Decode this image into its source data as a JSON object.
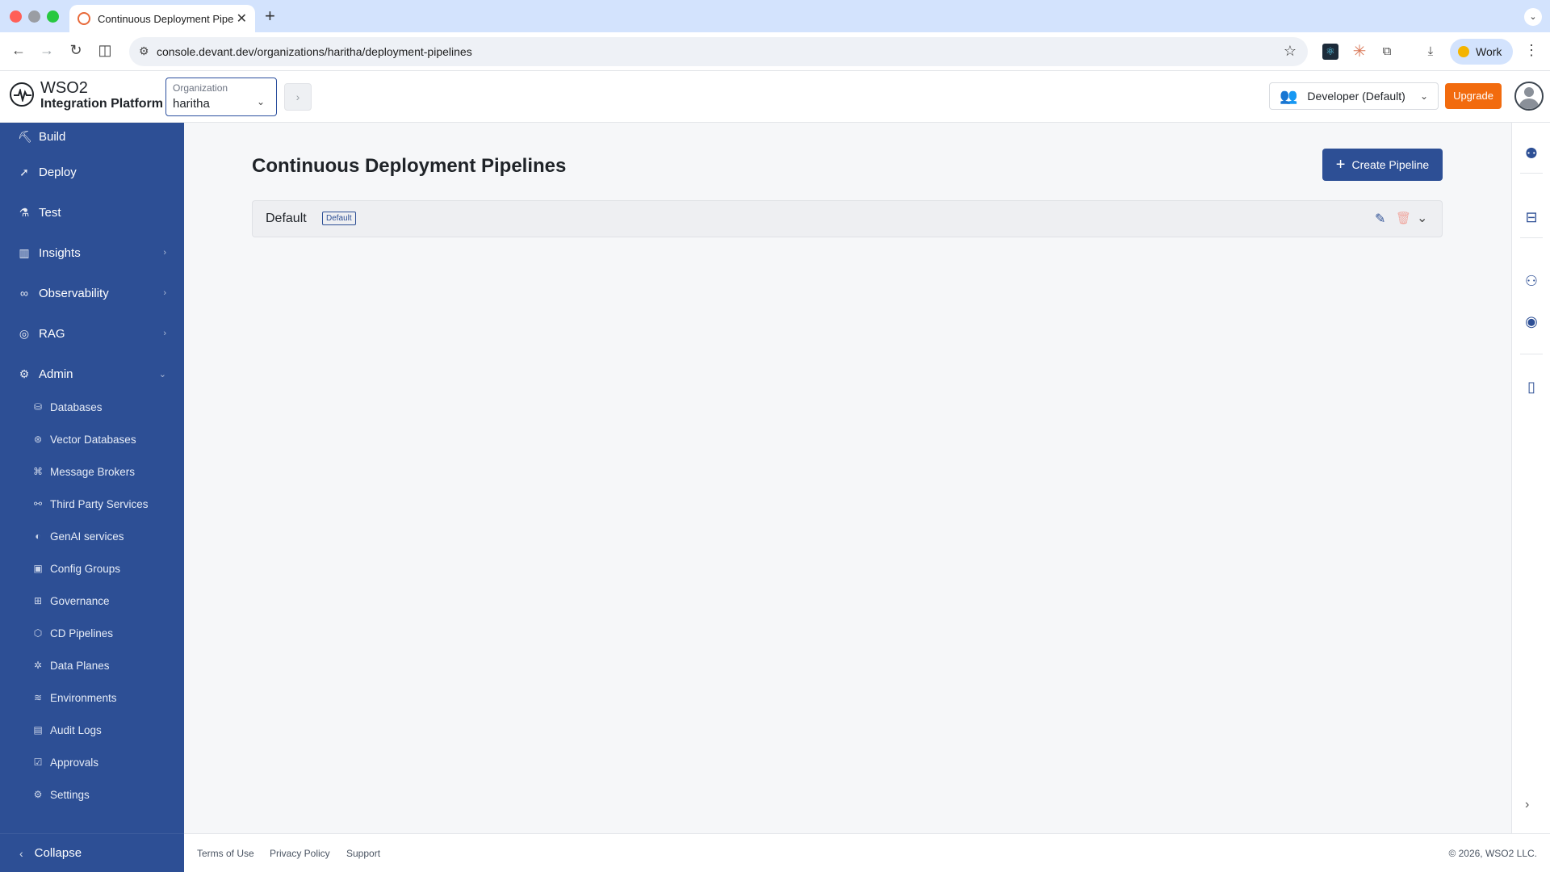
{
  "browser": {
    "tab_title": "Continuous Deployment Pipe",
    "url": "console.devant.dev/organizations/haritha/deployment-pipelines",
    "profile_label": "Work"
  },
  "header": {
    "logo_line1": "WSO2",
    "logo_line2": "Integration Platform",
    "org_label": "Organization",
    "org_value": "haritha",
    "role": "Developer (Default)",
    "upgrade_label": "Upgrade"
  },
  "sidebar": {
    "items": [
      {
        "label": "Build",
        "icon": "build-icon"
      },
      {
        "label": "Deploy",
        "icon": "rocket-icon"
      },
      {
        "label": "Test",
        "icon": "flask-icon"
      },
      {
        "label": "Insights",
        "icon": "chart-icon"
      },
      {
        "label": "Observability",
        "icon": "binoculars-icon"
      },
      {
        "label": "RAG",
        "icon": "brain-icon"
      },
      {
        "label": "Admin",
        "icon": "admin-icon"
      }
    ],
    "admin_items": [
      {
        "label": "Databases",
        "icon": "database-icon"
      },
      {
        "label": "Vector Databases",
        "icon": "vector-database-icon"
      },
      {
        "label": "Message Brokers",
        "icon": "broker-icon"
      },
      {
        "label": "Third Party Services",
        "icon": "services-icon"
      },
      {
        "label": "GenAI services",
        "icon": "genai-icon"
      },
      {
        "label": "Config Groups",
        "icon": "config-icon"
      },
      {
        "label": "Governance",
        "icon": "governance-icon"
      },
      {
        "label": "CD Pipelines",
        "icon": "pipeline-icon"
      },
      {
        "label": "Data Planes",
        "icon": "dataplane-icon"
      },
      {
        "label": "Environments",
        "icon": "layers-icon"
      },
      {
        "label": "Audit Logs",
        "icon": "audit-icon"
      },
      {
        "label": "Approvals",
        "icon": "approvals-icon"
      },
      {
        "label": "Settings",
        "icon": "gear-icon"
      }
    ],
    "collapse_label": "Collapse"
  },
  "main": {
    "title": "Continuous Deployment Pipelines",
    "create_button": "Create Pipeline",
    "pipelines": [
      {
        "name": "Default",
        "badge": "Default"
      }
    ]
  },
  "footer": {
    "links": [
      "Terms of Use",
      "Privacy Policy",
      "Support"
    ],
    "copyright": "© 2026, WSO2 LLC."
  },
  "colors": {
    "sidebar_bg": "#2d4f95",
    "primary": "#2d4f95",
    "upgrade": "#f26b0e"
  }
}
